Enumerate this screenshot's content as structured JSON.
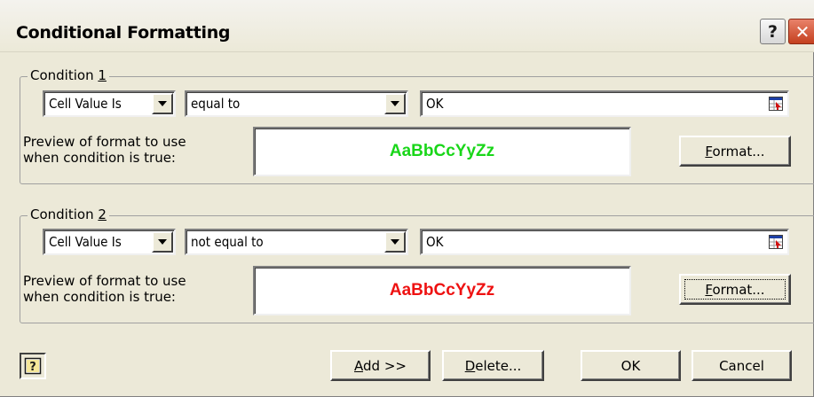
{
  "window": {
    "title": "Conditional Formatting",
    "help_glyph": "?",
    "close_glyph": "✕"
  },
  "conditions": [
    {
      "label_prefix": "Condition ",
      "label_mnemonic": "1",
      "operand_type": "Cell Value Is",
      "operator": "equal to",
      "value": "OK",
      "preview_label_line1": "Preview of format to use",
      "preview_label_line2": "when condition is true:",
      "preview_text": "AaBbCcYyZz",
      "preview_color": "#19d619",
      "format_button_mnemonic": "F",
      "format_button_rest": "ormat..."
    },
    {
      "label_prefix": "Condition ",
      "label_mnemonic": "2",
      "operand_type": "Cell Value Is",
      "operator": "not equal to",
      "value": "OK",
      "preview_label_line1": "Preview of format to use",
      "preview_label_line2": "when condition is true:",
      "preview_text": "AaBbCcYyZz",
      "preview_color": "#ee1111",
      "format_button_mnemonic": "F",
      "format_button_rest": "ormat..."
    }
  ],
  "footer": {
    "add_mnemonic": "A",
    "add_rest": "dd >>",
    "delete_mnemonic": "D",
    "delete_rest": "elete...",
    "ok_label": "OK",
    "cancel_label": "Cancel"
  },
  "colors": {
    "dialog_bg": "#ece9d8",
    "close_button": "#c4401f"
  },
  "icons": {
    "help": "help-question-icon",
    "close": "close-icon",
    "dropdown": "chevron-down-icon",
    "range_ref": "collapse-dialog-range-icon",
    "context_help": "context-help-icon"
  }
}
